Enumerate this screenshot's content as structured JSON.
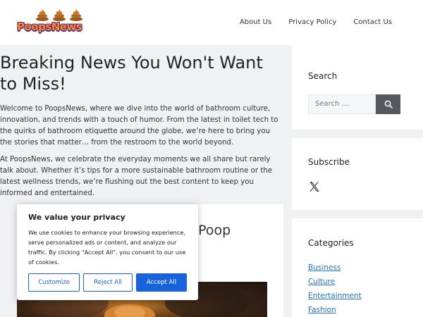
{
  "header": {
    "logo_text": "PoopsNews",
    "nav": [
      "About Us",
      "Privacy Policy",
      "Contact Us"
    ]
  },
  "main": {
    "title": "Breaking News You Won't Want to Miss!",
    "intro_1": "Welcome to PoopsNews, where we dive into the world of bathroom culture, innovation, and trends with a touch of humor. From the latest in toilet tech to the quirks of bathroom etiquette around the globe, we’re here to bring you the stories that matter… from the restroom to the world beyond.",
    "intro_2": "At PoopsNews, we celebrate the everyday moments we all share but rarely talk about. Whether it’s tips for a more sustainable bathroom routine or the latest wellness trends, we’re flushing out the best content to keep you informed and entertained.",
    "card_title_fragment": "at Poop\nup"
  },
  "sidebar": {
    "search_title": "Search",
    "search_placeholder": "Search …",
    "subscribe_title": "Subscribe",
    "categories_title": "Categories",
    "categories": [
      "Business",
      "Culture",
      "Entertainment",
      "Fashion"
    ]
  },
  "cookie": {
    "title": "We value your privacy",
    "text": "We use cookies to enhance your browsing experience, serve personalized ads or content, and analyze our traffic. By clicking \"Accept All\", you consent to our use of cookies.",
    "customize": "Customize",
    "reject": "Reject All",
    "accept": "Accept All"
  },
  "colors": {
    "accent": "#1863dc",
    "link": "#1e73be",
    "logo_orange": "#ff8a1f",
    "logo_purple": "#5b2a86"
  }
}
